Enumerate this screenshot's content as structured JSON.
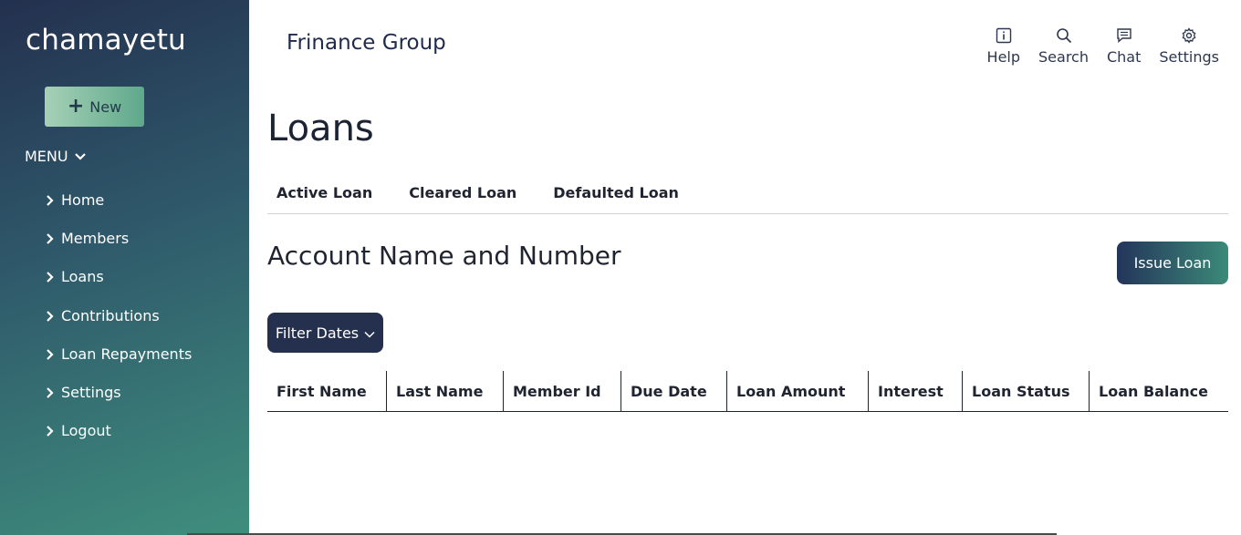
{
  "sidebar": {
    "brand": "chamayetu",
    "new_button": "New",
    "menu_label": "MENU",
    "items": [
      {
        "label": "Home"
      },
      {
        "label": "Members"
      },
      {
        "label": "Loans"
      },
      {
        "label": "Contributions"
      },
      {
        "label": "Loan Repayments"
      },
      {
        "label": "Settings"
      },
      {
        "label": "Logout"
      }
    ]
  },
  "header": {
    "group_name": "Frinance Group",
    "actions": [
      {
        "label": "Help",
        "icon": "info-icon"
      },
      {
        "label": "Search",
        "icon": "search-icon"
      },
      {
        "label": "Chat",
        "icon": "chat-icon"
      },
      {
        "label": "Settings",
        "icon": "gear-icon"
      }
    ]
  },
  "main": {
    "title": "Loans",
    "tabs": [
      {
        "label": "Active Loan"
      },
      {
        "label": "Cleared Loan"
      },
      {
        "label": "Defaulted Loan"
      }
    ],
    "section_title": "Account Name and Number",
    "issue_button": "Issue Loan",
    "filter_button": "Filter Dates",
    "table": {
      "columns": [
        "First Name",
        "Last Name",
        "Member Id",
        "Due Date",
        "Loan Amount",
        "Interest",
        "Loan Status",
        "Loan Balance"
      ],
      "rows": []
    }
  },
  "colors": {
    "sidebar_gradient_start": "#23304f",
    "sidebar_gradient_end": "#3f8e7d",
    "new_button": "#5fa88c",
    "filter_button": "#25304f",
    "issue_button_start": "#24355a",
    "issue_button_end": "#3b8a79"
  }
}
